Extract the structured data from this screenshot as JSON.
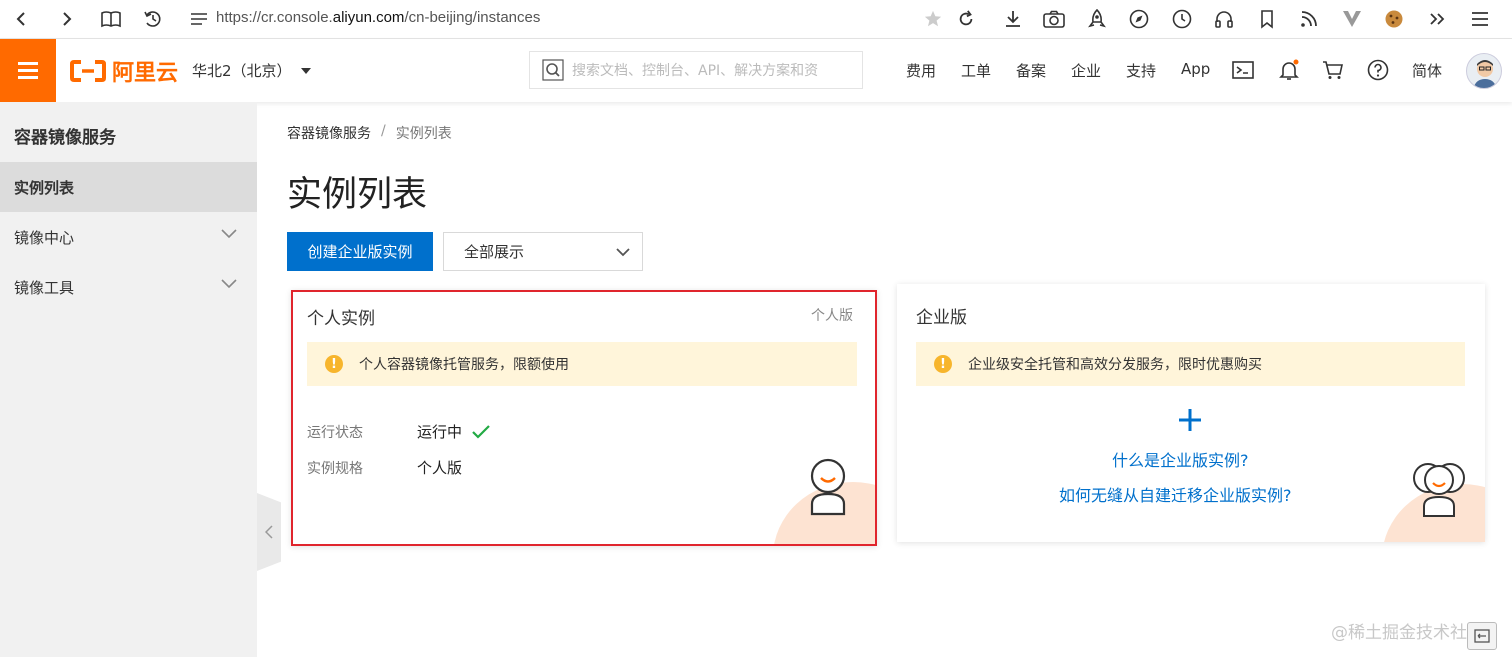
{
  "browser": {
    "url_prefix": "https://cr.console.",
    "url_host": "aliyun.com",
    "url_path": "/cn-beijing/instances"
  },
  "header": {
    "logo_text": "阿里云",
    "region": "华北2（北京）",
    "search_placeholder": "搜索文档、控制台、API、解决方案和资",
    "nav": [
      "费用",
      "工单",
      "备案",
      "企业",
      "支持",
      "App"
    ],
    "lang": "简体",
    "brand_color": "#ff6a00"
  },
  "sidebar": {
    "title": "容器镜像服务",
    "items": [
      {
        "label": "实例列表",
        "active": true
      },
      {
        "label": "镜像中心",
        "expandable": true
      },
      {
        "label": "镜像工具",
        "expandable": true
      }
    ]
  },
  "main": {
    "breadcrumb": [
      "容器镜像服务",
      "/",
      "实例列表"
    ],
    "title": "实例列表",
    "create_button": "创建企业版实例",
    "filter_select": "全部展示",
    "accent_color": "#0070cc"
  },
  "cards": {
    "personal": {
      "title": "个人实例",
      "tag": "个人版",
      "notice": "个人容器镜像托管服务，限额使用",
      "status_label": "运行状态",
      "status_value": "运行中",
      "spec_label": "实例规格",
      "spec_value": "个人版"
    },
    "enterprise": {
      "title": "企业版",
      "notice": "企业级安全托管和高效分发服务，限时优惠购买",
      "link1": "什么是企业版实例?",
      "link2": "如何无缝从自建迁移企业版实例?"
    }
  },
  "watermark": "@稀土掘金技术社区"
}
